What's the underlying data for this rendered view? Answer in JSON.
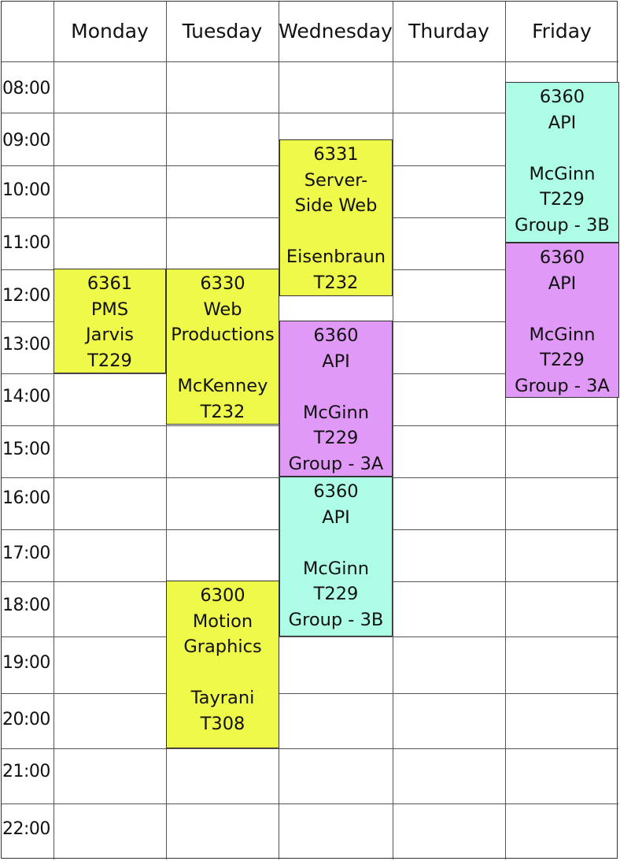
{
  "days": [
    "Monday",
    "Tuesday",
    "Wednesday",
    "Thurday",
    "Friday"
  ],
  "times": [
    "08:00",
    "09:00",
    "10:00",
    "11:00",
    "12:00",
    "13:00",
    "14:00",
    "15:00",
    "16:00",
    "17:00",
    "18:00",
    "19:00",
    "20:00",
    "21:00",
    "22:00"
  ],
  "colors": {
    "yellow": "#eef94a",
    "purple": "#e199f7",
    "aqua": "#aefde6"
  },
  "events": [
    {
      "id": "mon-6361",
      "day": "Monday",
      "color": "yellow",
      "lines": [
        "6361",
        "PMS",
        "Jarvis",
        "T229"
      ]
    },
    {
      "id": "tue-6330",
      "day": "Tuesday",
      "color": "yellow",
      "lines": [
        "6330",
        "Web",
        "Productions",
        "",
        "McKenney",
        "T232"
      ]
    },
    {
      "id": "tue-6300",
      "day": "Tuesday",
      "color": "yellow",
      "lines": [
        "6300",
        "Motion",
        "Graphics",
        "",
        "Tayrani",
        "T308"
      ]
    },
    {
      "id": "wed-6331",
      "day": "Wednesday",
      "color": "yellow",
      "lines": [
        "6331",
        "Server-",
        "Side Web",
        "",
        "Eisenbraun",
        "T232"
      ]
    },
    {
      "id": "wed-6360-3a",
      "day": "Wednesday",
      "color": "purple",
      "lines": [
        "6360",
        "API",
        "",
        "McGinn",
        "T229",
        "Group - 3A"
      ]
    },
    {
      "id": "wed-6360-3b",
      "day": "Wednesday",
      "color": "aqua",
      "lines": [
        "6360",
        "API",
        "",
        "McGinn",
        "T229",
        "Group - 3B"
      ]
    },
    {
      "id": "fri-6360-3b",
      "day": "Friday",
      "color": "aqua",
      "lines": [
        "6360",
        "API",
        "",
        "McGinn",
        "T229",
        "Group - 3B"
      ]
    },
    {
      "id": "fri-6360-3a",
      "day": "Friday",
      "color": "purple",
      "lines": [
        "6360",
        "API",
        "",
        "McGinn",
        "T229",
        "Group - 3A"
      ]
    }
  ]
}
